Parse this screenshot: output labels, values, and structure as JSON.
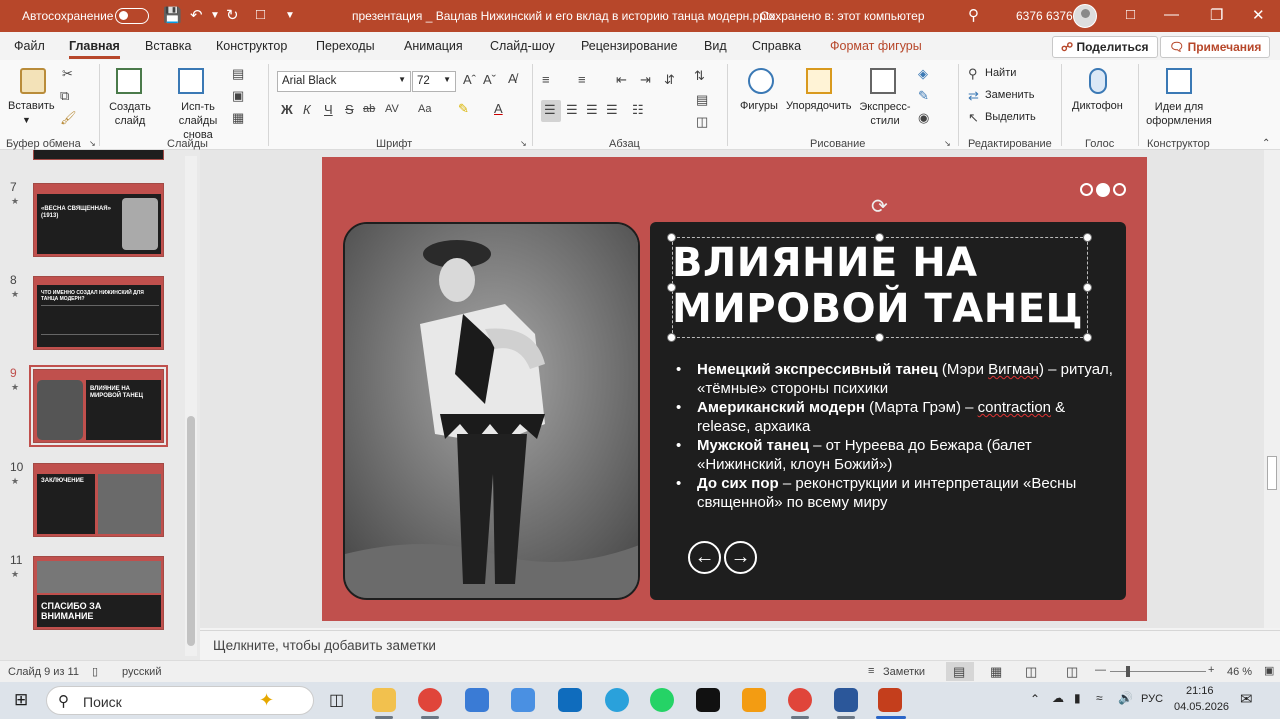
{
  "titlebar": {
    "autosave_label": "Автосохранение",
    "doc_title": "презентация _ Вацлав Нижинский и его вклад в историю танца модерн.pptx",
    "save_status": "Сохранено в: этот компьютер",
    "user": "6376 6376"
  },
  "tabs": [
    "Файл",
    "Главная",
    "Вставка",
    "Конструктор",
    "Переходы",
    "Анимация",
    "Слайд-шоу",
    "Рецензирование",
    "Вид",
    "Справка",
    "Формат фигуры"
  ],
  "share_label": "Поделиться",
  "comments_label": "Примечания",
  "ribbon": {
    "paste": "Вставить",
    "new_slide": "Создать слайд",
    "reuse": "Исп-ть слайды снова",
    "font_name": "Arial Black",
    "font_size": "72",
    "shapes": "Фигуры",
    "arrange": "Упорядочить",
    "quick_styles": "Экспресс-стили",
    "find": "Найти",
    "replace": "Заменить",
    "select": "Выделить",
    "dictate": "Диктофон",
    "designer": "Идеи для оформления",
    "groups": [
      "Буфер обмена",
      "Слайды",
      "Шрифт",
      "Абзац",
      "Рисование",
      "Редактирование",
      "Голос",
      "Конструктор"
    ],
    "format_letters": [
      "Ж",
      "К",
      "Ч",
      "S",
      "ab",
      "AV",
      "Aa"
    ]
  },
  "thumbnails": [
    {
      "num": "7",
      "title": "«ВЕСНА СВЯЩЕННАЯ» (1913)"
    },
    {
      "num": "8",
      "title": "ЧТО ИМЕННО СОЗДАЛ НИЖИНСКИЙ ДЛЯ ТАНЦА МОДЕРН?"
    },
    {
      "num": "9",
      "title": "ВЛИЯНИЕ НА МИРОВОЙ ТАНЕЦ"
    },
    {
      "num": "10",
      "title": "ЗАКЛЮЧЕНИЕ"
    },
    {
      "num": "11",
      "title": "СПАСИБО ЗА ВНИМАНИЕ"
    }
  ],
  "slide": {
    "title": "ВЛИЯНИЕ НА МИРОВОЙ ТАНЕЦ",
    "bullets": [
      {
        "bold": "Немецкий экспрессивный танец",
        "rest_a": " (Мэри ",
        "squig": "Вигман",
        "rest_b": ") – ритуал, «тёмные» стороны психики"
      },
      {
        "bold": "Американский модерн",
        "rest_a": " (Марта Грэм) – ",
        "squig": "contraction",
        "rest_b": " & release, архаика"
      },
      {
        "bold": "Мужской танец",
        "rest_a": " – от Нуреева до Бежара (балет «Нижинский, клоун Божий»)",
        "squig": "",
        "rest_b": ""
      },
      {
        "bold": "До сих пор",
        "rest_a": " – реконструкции и интерпретации «Весны священной» по всему миру",
        "squig": "",
        "rest_b": ""
      }
    ]
  },
  "notes_placeholder": "Щелкните, чтобы добавить заметки",
  "status": {
    "slide_counter": "Слайд 9 из 11",
    "language": "русский",
    "notes_button": "Заметки",
    "zoom": "46 %"
  },
  "taskbar": {
    "search": "Поиск",
    "lang": "РУС",
    "time": "21:16",
    "date": "04.05.2026"
  }
}
